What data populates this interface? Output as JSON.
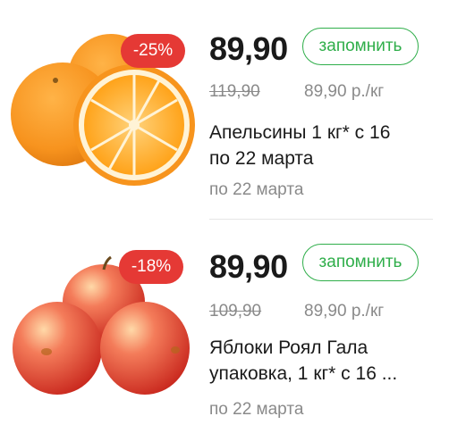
{
  "products": [
    {
      "discount": "-25%",
      "price": "89,90",
      "remember_label": "запомнить",
      "old_price": "119,90",
      "unit_price": "89,90 р./кг",
      "title_line1": "Апельсины 1 кг* с 16",
      "title_line2": "по 22 марта",
      "until": "по 22 марта",
      "image_icon": "oranges-image"
    },
    {
      "discount": "-18%",
      "price": "89,90",
      "remember_label": "запомнить",
      "old_price": "109,90",
      "unit_price": "89,90 р./кг",
      "title_line1": "Яблоки Роял Гала",
      "title_line2": "упаковка, 1 кг* с 16 ...",
      "until": "по 22 марта",
      "image_icon": "apples-image"
    }
  ],
  "colors": {
    "accent": "#2fae4a",
    "discount_badge": "#e53935",
    "muted_text": "#8a8a8a"
  }
}
